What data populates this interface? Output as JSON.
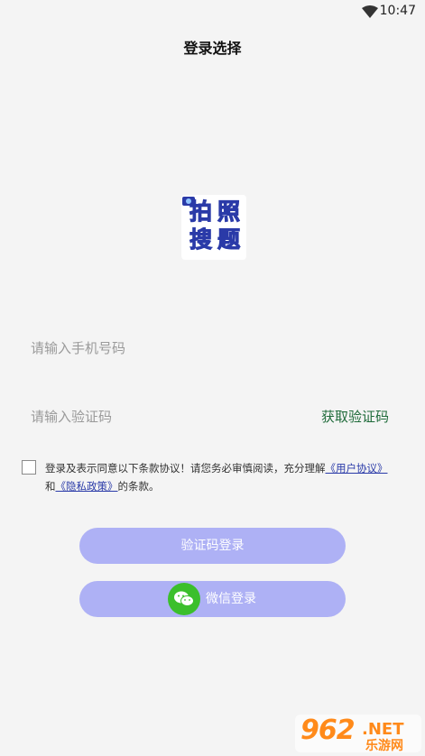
{
  "status_bar": {
    "time": "10:47",
    "icons": [
      "wifi-icon"
    ]
  },
  "header": {
    "title": "登录选择"
  },
  "logo": {
    "chars": [
      "拍",
      "照",
      "搜",
      "题"
    ]
  },
  "form": {
    "phone_placeholder": "请输入手机号码",
    "code_placeholder": "请输入验证码",
    "get_code_label": "获取验证码"
  },
  "agreement": {
    "text_before": "登录及表示同意以下条款协议！请您务必审慎阅读，充分理解",
    "user_agreement": "《用户协议》",
    "and": "和",
    "privacy_policy": "《隐私政策》",
    "text_after": "的条款。"
  },
  "buttons": {
    "code_login": "验证码登录",
    "wechat_login": "微信登录"
  },
  "watermark": {
    "number": "962",
    "suffix": ".NET",
    "cn": "乐游网"
  },
  "colors": {
    "background": "#f4f4f4",
    "button": "#aeb1f5",
    "get_code": "#1f6b3a",
    "link": "#2a3aa8",
    "wechat": "#3bbf2c"
  }
}
